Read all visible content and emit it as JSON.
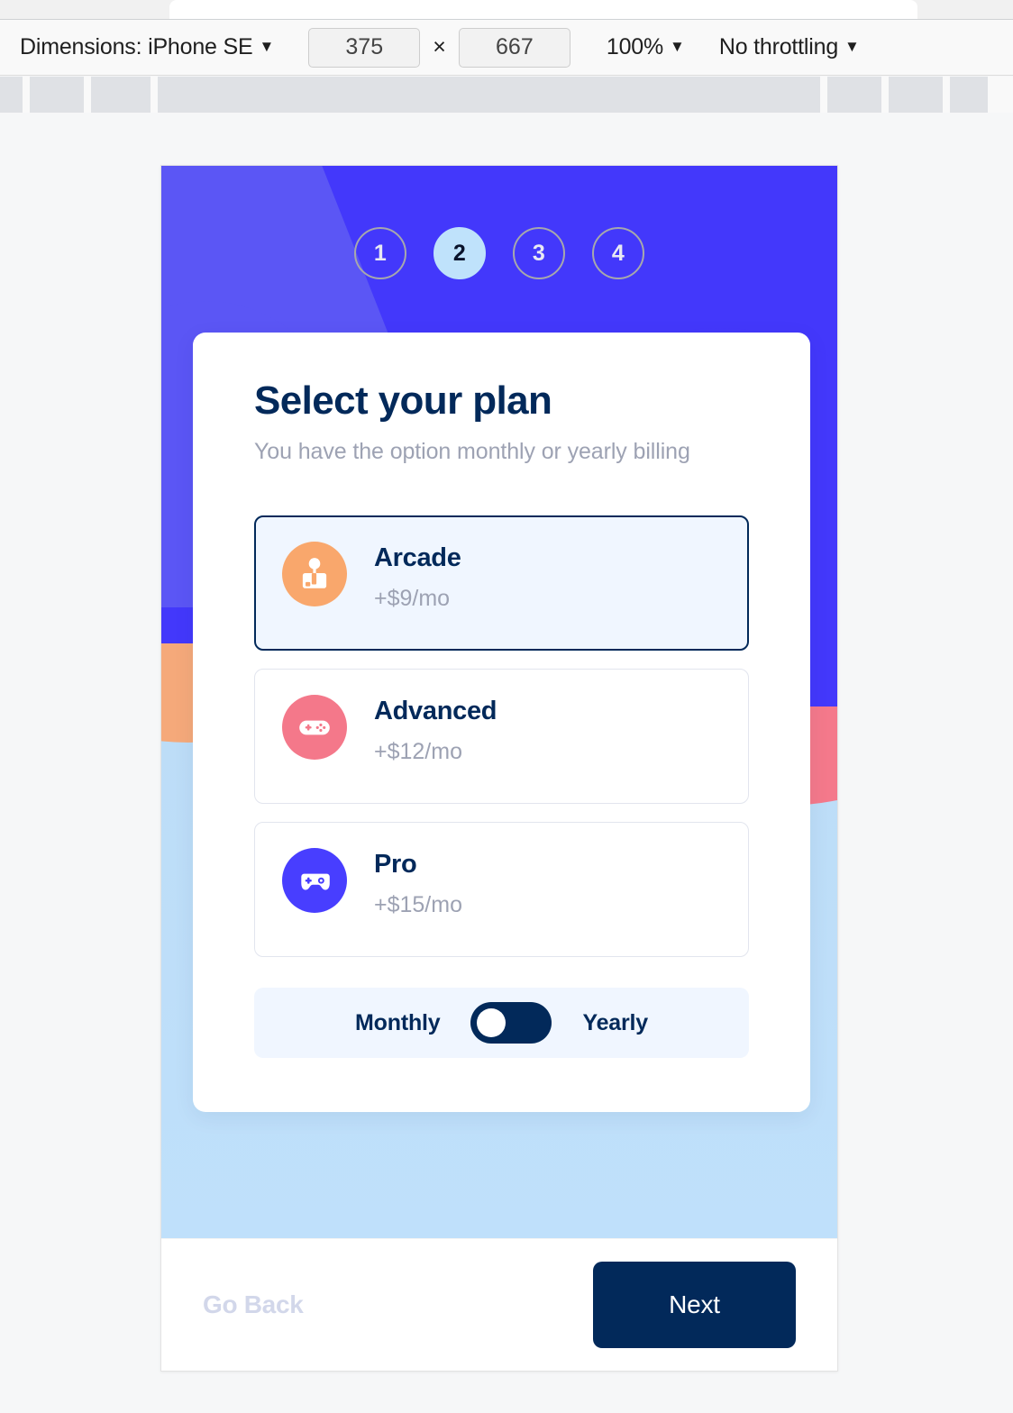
{
  "devtools": {
    "dimensions_label": "Dimensions: iPhone SE",
    "width_value": "375",
    "height_value": "667",
    "times_symbol": "×",
    "zoom_label": "100%",
    "throttling_label": "No throttling",
    "caret": "▼"
  },
  "steps": [
    {
      "number": "1",
      "active": false
    },
    {
      "number": "2",
      "active": true
    },
    {
      "number": "3",
      "active": false
    },
    {
      "number": "4",
      "active": false
    }
  ],
  "card": {
    "title": "Select your plan",
    "subtitle": "You have the option monthly or yearly billing"
  },
  "plans": [
    {
      "name": "Arcade",
      "price": "+$9/mo",
      "icon": "arcade-joystick-icon",
      "icon_color": "#f9a76c",
      "selected": true
    },
    {
      "name": "Advanced",
      "price": "+$12/mo",
      "icon": "gamepad-icon",
      "icon_color": "#f4788a",
      "selected": false
    },
    {
      "name": "Pro",
      "price": "+$15/mo",
      "icon": "controller-icon",
      "icon_color": "#483eff",
      "selected": false
    }
  ],
  "billing": {
    "monthly_label": "Monthly",
    "yearly_label": "Yearly",
    "selected": "Monthly"
  },
  "footer": {
    "back_label": "Go Back",
    "next_label": "Next"
  },
  "colors": {
    "primary_purple": "#4338fb",
    "light_purple": "#5b56f5",
    "orange": "#f5a97a",
    "pink": "#f4798b",
    "light_blue": "#bcdcf6",
    "navy": "#02295a",
    "selected_bg": "#f0f6ff",
    "muted_text": "#9da2b3",
    "step_active_bg": "#bfe2fb"
  }
}
